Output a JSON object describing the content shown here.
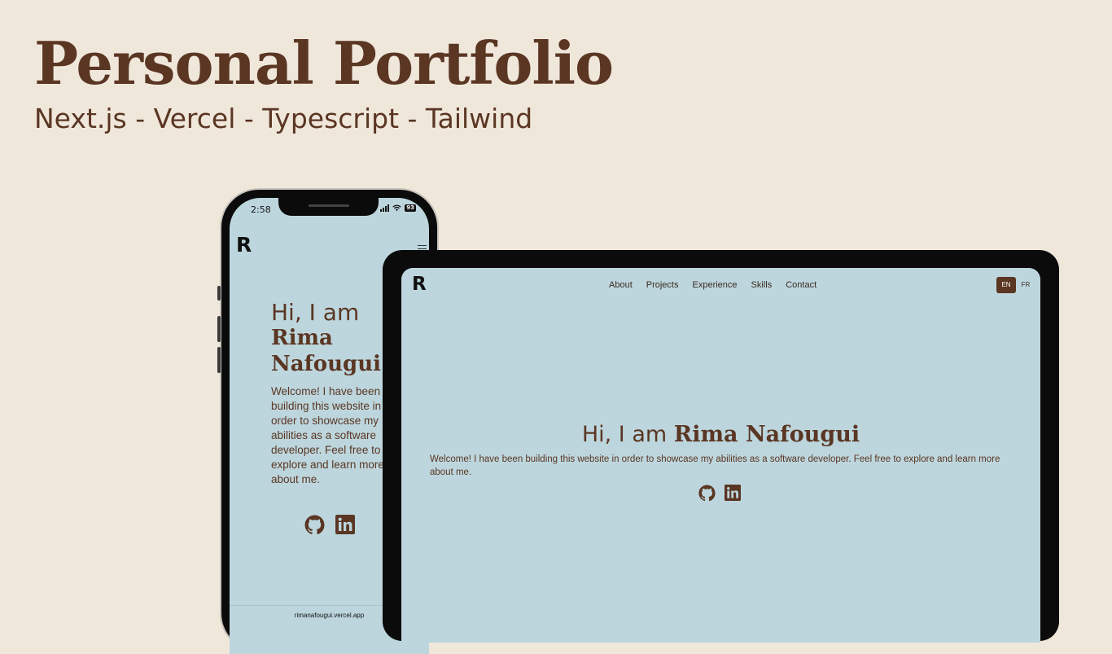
{
  "header": {
    "title": "Personal Portfolio",
    "subtitle": "Next.js - Vercel - Typescript - Tailwind"
  },
  "phone": {
    "status_time": "2:58",
    "battery": "93",
    "logo": "R",
    "hero": {
      "greeting": "Hi, I am",
      "name": "Rima Nafougui",
      "description": "Welcome! I have been building this website in order to showcase my abilities as a software developer. Feel free to explore and learn more about me."
    },
    "url": "rimanafougui.vercel.app",
    "icons": [
      "github-icon",
      "linkedin-icon",
      "hamburger-menu-icon",
      "wifi-icon",
      "signal-icon"
    ]
  },
  "tablet": {
    "logo": "R",
    "nav": [
      "About",
      "Projects",
      "Experience",
      "Skills",
      "Contact"
    ],
    "languages": {
      "active": "EN",
      "inactive": "FR"
    },
    "hero": {
      "greeting": "Hi, I am",
      "name": "Rima Nafougui",
      "description": "Welcome! I have been building this website in order to showcase my abilities as a software developer. Feel free to explore and learn more about me."
    },
    "icons": [
      "github-icon",
      "linkedin-icon"
    ]
  },
  "colors": {
    "background": "#f0e7db",
    "brand_brown": "#5a3623",
    "screen_blue": "#bdd6dd",
    "device_frame": "#0b0b0b"
  }
}
